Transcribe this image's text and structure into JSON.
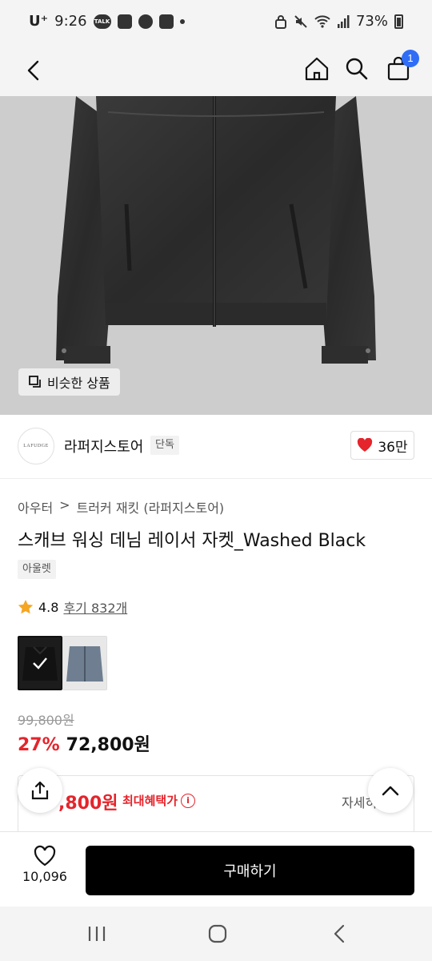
{
  "status_bar": {
    "carrier": "U⁺",
    "time": "9:26",
    "battery": "73%"
  },
  "header": {
    "cart_count": "1"
  },
  "hero": {
    "similar_label": "비슷한 상품"
  },
  "brand": {
    "logo_text": "LAFUDGE",
    "name": "라퍼지스토어",
    "tag": "단독",
    "likes": "36만"
  },
  "breadcrumb": {
    "category": "아우터",
    "separator": ">",
    "subcategory": "트러커 재킷 (라퍼지스토어)"
  },
  "product": {
    "title": "스캐브 워싱 데님 레이서 자켓_Washed Black",
    "outlet_tag": "아울렛",
    "rating": "4.8",
    "reviews": "후기 832개",
    "original_price": "99,800원",
    "discount": "27%",
    "sale_price": "72,800원"
  },
  "benefit": {
    "price": ",800원",
    "label": "최대혜택가",
    "info_glyph": "i",
    "detail": "자세히"
  },
  "bottom_bar": {
    "wish_count": "10,096",
    "buy_label": "구매하기"
  },
  "colors": {
    "accent_red": "#e5242b",
    "badge_blue": "#2f6df6",
    "buy_button": "#000000"
  },
  "icons": [
    "back-icon",
    "home-icon",
    "search-icon",
    "cart-icon",
    "similar-icon",
    "heart-icon",
    "star-icon",
    "check-icon",
    "share-icon",
    "chevron-up-icon",
    "heart-outline-icon",
    "recent-apps-icon",
    "home-circle-icon",
    "nav-back-icon"
  ]
}
